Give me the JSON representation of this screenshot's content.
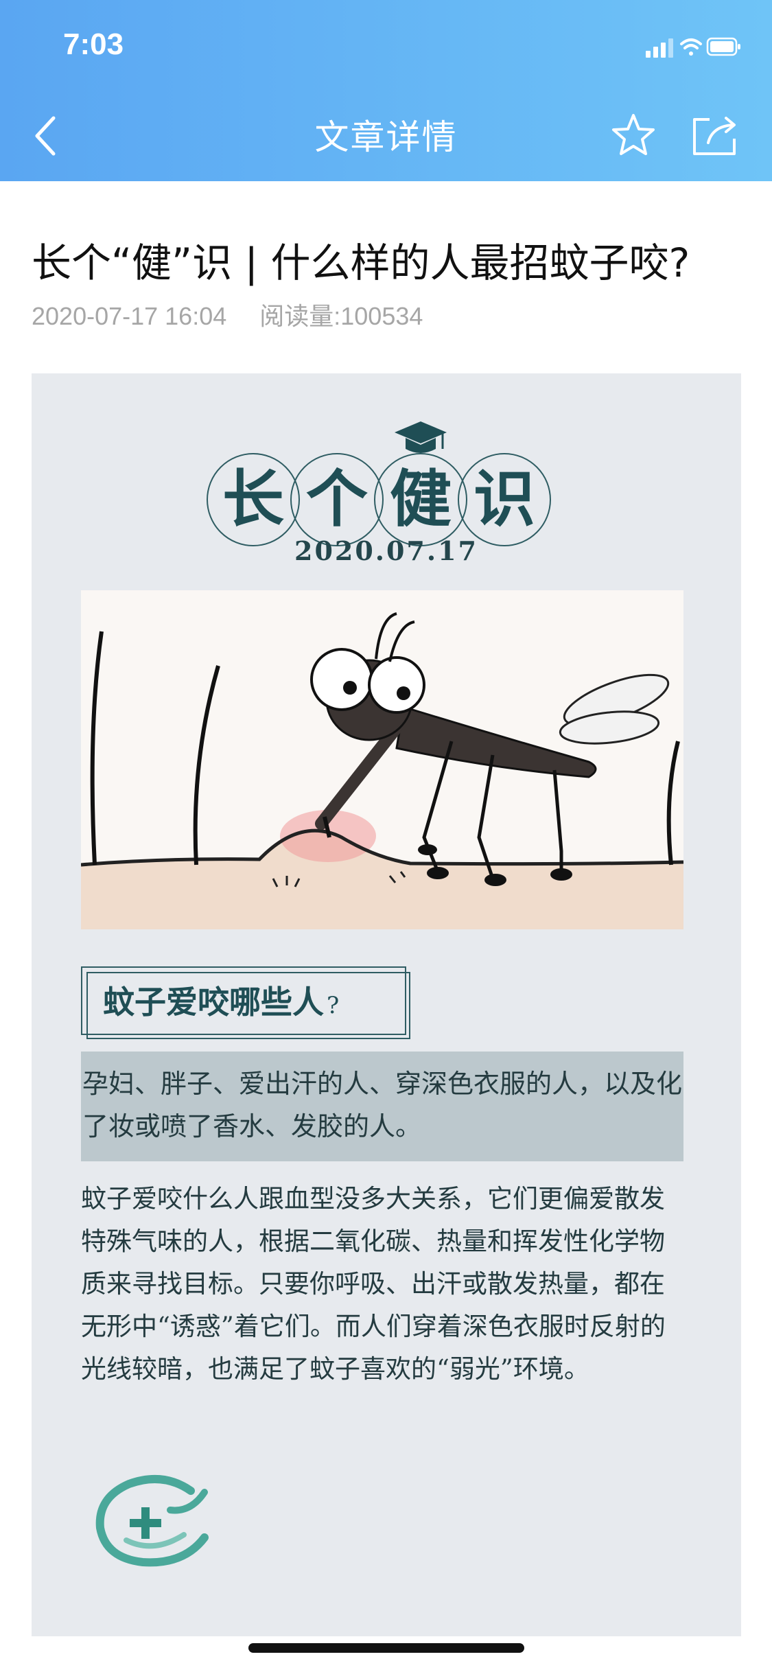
{
  "status_bar": {
    "time": "7:03"
  },
  "nav": {
    "title": "文章详情",
    "back_icon": "chevron-left-icon",
    "favorite_icon": "star-icon",
    "share_icon": "share-icon"
  },
  "article": {
    "title": "长个“健”识 | 什么样的人最招蚊子咬?",
    "date": "2020-07-17 16:04",
    "read_count": "阅读量:100534"
  },
  "card": {
    "logo_chars": [
      "长",
      "个",
      "健",
      "识"
    ],
    "logo_date": "2020.07.17",
    "question": "蚊子爱咬哪些人",
    "question_mark": "?",
    "highlight": "孕妇、胖子、爱出汗的人、穿深色衣服的人，以及化了妆或喷了香水、发胶的人。",
    "body": "蚊子爱咬什么人跟血型没多大关系，它们更偏爱散发特殊气味的人，根据二氧化碳、热量和挥发性化学物质来寻找目标。只要你呼吸、出汗或散发热量，都在无形中“诱惑”着它们。而人们穿着深色衣服时反射的光线较暗，也满足了蚊子喜欢的“弱光”环境。"
  },
  "colors": {
    "header_start": "#5aa6f2",
    "header_end": "#6fc4f7",
    "card_bg": "#e7eaee",
    "accent_teal": "#1f4e55",
    "logo_green": "#4aa89a"
  }
}
